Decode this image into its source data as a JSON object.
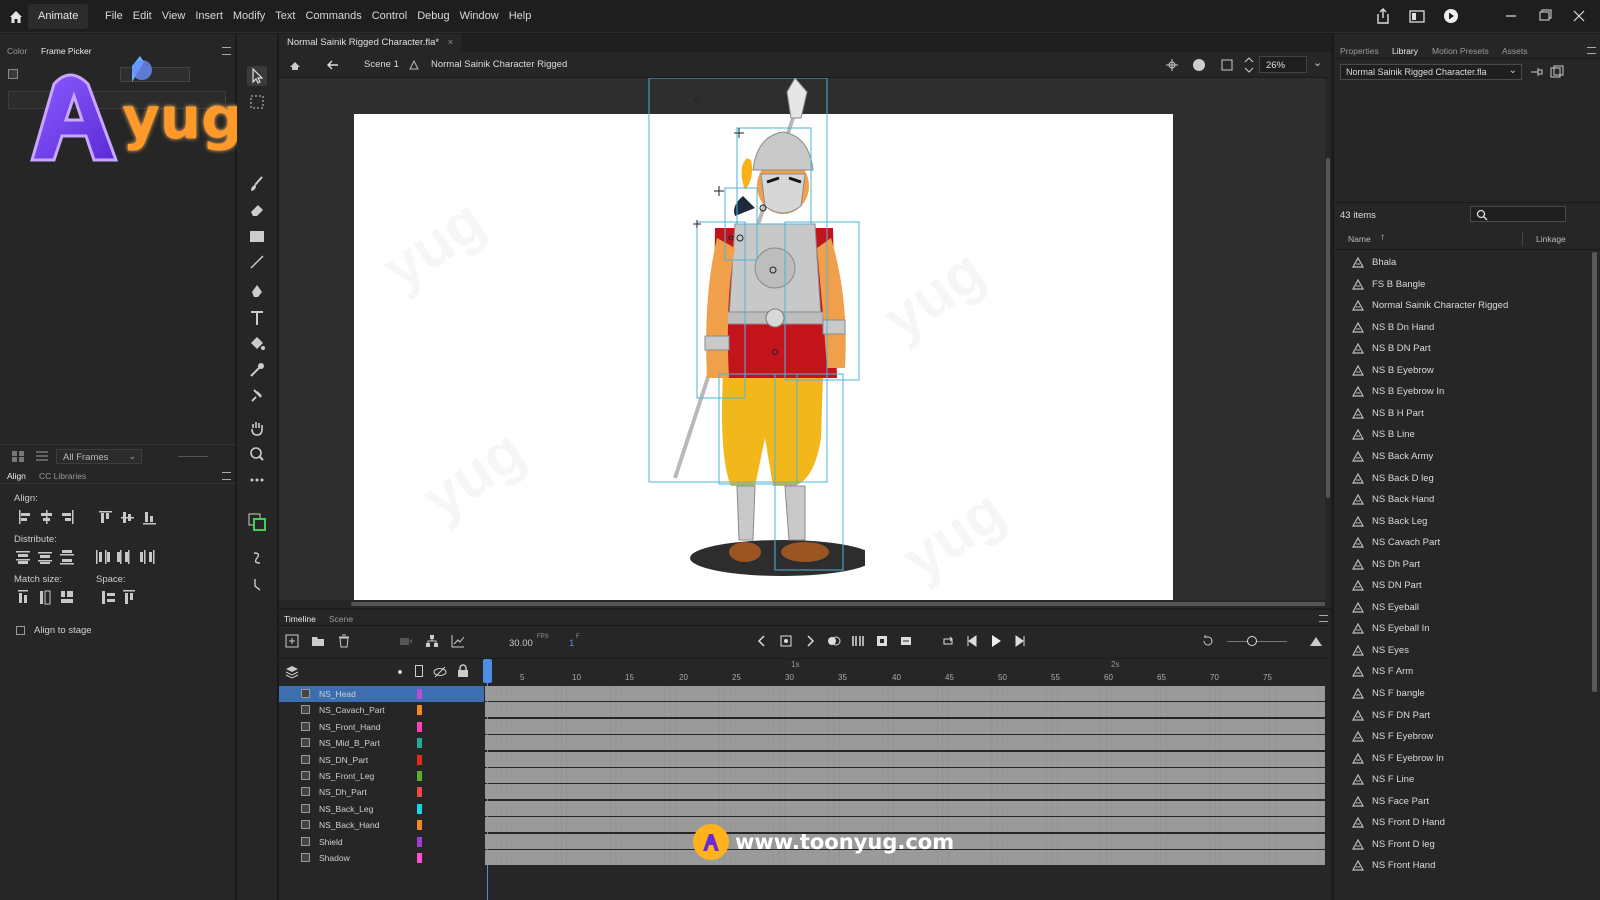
{
  "menubar": {
    "workspace": "Animate",
    "items": [
      "File",
      "Edit",
      "View",
      "Insert",
      "Modify",
      "Text",
      "Commands",
      "Control",
      "Debug",
      "Window",
      "Help"
    ]
  },
  "left_panel": {
    "tabs": [
      "Color",
      "Frame Picker"
    ],
    "frames_dropdown": "All Frames",
    "align_tabs": [
      "Align",
      "CC Libraries"
    ],
    "align_label": "Align:",
    "distribute_label": "Distribute:",
    "match_size_label": "Match size:",
    "space_label": "Space:",
    "align_to_stage": "Align to stage"
  },
  "document": {
    "tab_title": "Normal Sainik Rigged Character.fla*",
    "scene": "Scene 1",
    "symbol": "Normal Sainik Character Rigged",
    "zoom": "26%"
  },
  "timeline": {
    "tabs": [
      "Timeline",
      "Scene"
    ],
    "fps": "30.00",
    "fps_unit": "FPS",
    "current_frame": "1",
    "frame_unit": "F",
    "second_markers": [
      "1s",
      "2s"
    ],
    "frame_numbers": [
      "5",
      "10",
      "15",
      "20",
      "25",
      "30",
      "35",
      "40",
      "45",
      "50",
      "55",
      "60",
      "65",
      "70",
      "75"
    ],
    "layers": [
      {
        "name": "NS_Head",
        "color": "#b44fd6",
        "selected": true
      },
      {
        "name": "NS_Cavach_Part",
        "color": "#f08a1c"
      },
      {
        "name": "NS_Front_Hand",
        "color": "#ff3fb9"
      },
      {
        "name": "NS_Mid_B_Part",
        "color": "#1fa8a0"
      },
      {
        "name": "NS_DN_Part",
        "color": "#e3291f"
      },
      {
        "name": "NS_Front_Leg",
        "color": "#5fae25"
      },
      {
        "name": "NS_Dh_Part",
        "color": "#f04747"
      },
      {
        "name": "NS_Back_Leg",
        "color": "#19d6e6"
      },
      {
        "name": "NS_Back_Hand",
        "color": "#f08a1c"
      },
      {
        "name": "Shield",
        "color": "#9b3fd6"
      },
      {
        "name": "Shadow",
        "color": "#ff4fd8"
      }
    ]
  },
  "right_panel": {
    "tabs": [
      "Properties",
      "Library",
      "Motion Presets",
      "Assets"
    ],
    "library_file": "Normal Sainik Rigged Character.fla",
    "item_count": "43 items",
    "col_name": "Name",
    "col_linkage": "Linkage",
    "items": [
      "Bhala",
      "FS B Bangle",
      "Normal Sainik Character Rigged",
      "NS B Dn Hand",
      "NS B DN Part",
      "NS B Eyebrow",
      "NS B Eyebrow In",
      "NS B H Part",
      "NS B Line",
      "NS Back Army",
      "NS Back D leg",
      "NS Back Hand",
      "NS Back Leg",
      "NS Cavach Part",
      "NS Dh Part",
      "NS DN Part",
      "NS Eyeball",
      "NS Eyeball In",
      "NS Eyes",
      "NS F Arm",
      "NS F bangle",
      "NS F DN Part",
      "NS F Eyebrow",
      "NS F Eyebrow In",
      "NS F Line",
      "NS Face Part",
      "NS Front D Hand",
      "NS Front D leg",
      "NS Front Hand"
    ]
  },
  "branding": {
    "logo_text": "yug",
    "website": "www.toonyug.com"
  },
  "colors": {
    "accent": "#4c8fe0",
    "stage": "#ffffff",
    "frame_gray": "#9a9a9a"
  }
}
